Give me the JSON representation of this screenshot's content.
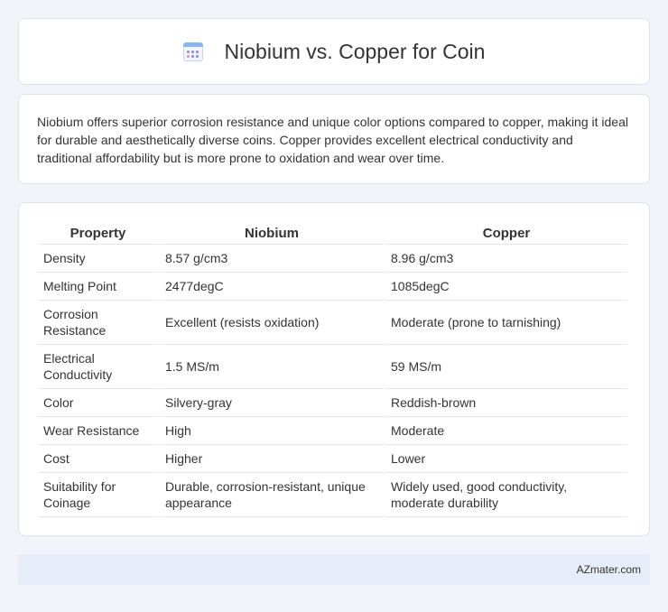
{
  "header": {
    "icon": "calendar-icon",
    "title": "Niobium vs. Copper for Coin"
  },
  "description": "Niobium offers superior corrosion resistance and unique color options compared to copper, making it ideal for durable and aesthetically diverse coins. Copper provides excellent electrical conductivity and traditional affordability but is more prone to oxidation and wear over time.",
  "table": {
    "headers": [
      "Property",
      "Niobium",
      "Copper"
    ],
    "rows": [
      [
        "Density",
        "8.57 g/cm3",
        "8.96 g/cm3"
      ],
      [
        "Melting Point",
        "2477degC",
        "1085degC"
      ],
      [
        "Corrosion Resistance",
        "Excellent (resists oxidation)",
        "Moderate (prone to tarnishing)"
      ],
      [
        "Electrical Conductivity",
        "1.5 MS/m",
        "59 MS/m"
      ],
      [
        "Color",
        "Silvery-gray",
        "Reddish-brown"
      ],
      [
        "Wear Resistance",
        "High",
        "Moderate"
      ],
      [
        "Cost",
        "Higher",
        "Lower"
      ],
      [
        "Suitability for Coinage",
        "Durable, corrosion-resistant, unique appearance",
        "Widely used, good conductivity, moderate durability"
      ]
    ]
  },
  "footer": {
    "brand": "AZmater.com"
  }
}
